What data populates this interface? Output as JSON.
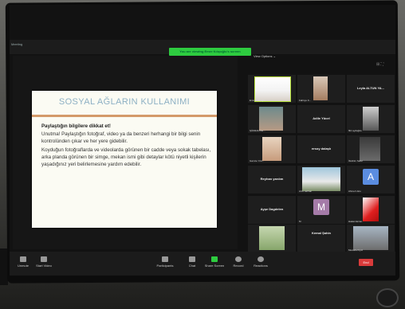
{
  "zoom": {
    "meeting_label": "Meeting",
    "viewing_banner": "You are viewing Emre Kılıçoğlu's screen",
    "view_options": "View Options ⌄"
  },
  "slide": {
    "title": "SOSYAL AĞLARIN KULLANIMI",
    "heading": "Paylaştığın bilgilere dikkat et!",
    "paragraph1": "Unutma! Paylaştığın fotoğraf, video ya da benzeri herhangi bir bilgi senin kontrolünden çıkar ve her yere gidebilir.",
    "paragraph2": "Koyduğun fotoğraflarda ve videolarda görünen bir cadde veya sokak tabelası, arka planda görünen bir simge, mekan ismi gibi detaylar kötü niyetli kişilerin yaşadığınız yeri belirlemesine yardım edebilir."
  },
  "participants": {
    "p1": "Emre Kılıçoğlu",
    "p2": "Fahriye K...",
    "p3": "Leyla ALTUN YA...",
    "p4": "ŞÜKRAN De...",
    "p5": "Adile Yücel",
    "p6": "filiz aydoğdu",
    "p7": "Gamze Yıld...",
    "p8": "ersoy dalaşlı",
    "p9": "İbrahim Sefer",
    "p10": "Reyhan yardım",
    "p11": "Arzu sarhan",
    "p12": "Ahmet Ustu",
    "p13": "Ayşe Dagdelen",
    "p14": "M",
    "p15": "Kemal Şahin",
    "p16": "Hakan Ercan",
    "p17": "Mustafa Kiyol",
    "avatar_m": "M",
    "avatar_a": "A"
  },
  "toolbar": {
    "unmute": "Unmute",
    "start_video": "Start Video",
    "participants": "Participants",
    "participant_count": "27",
    "chat": "Chat",
    "share_screen": "Share Screen",
    "record": "Record",
    "reactions": "Reactions",
    "end": "End"
  },
  "colors": {
    "banner": "#2ecc40",
    "slide_title": "#8db0c4",
    "end_button": "#d93b3b",
    "share_screen": "#2ecc40"
  }
}
